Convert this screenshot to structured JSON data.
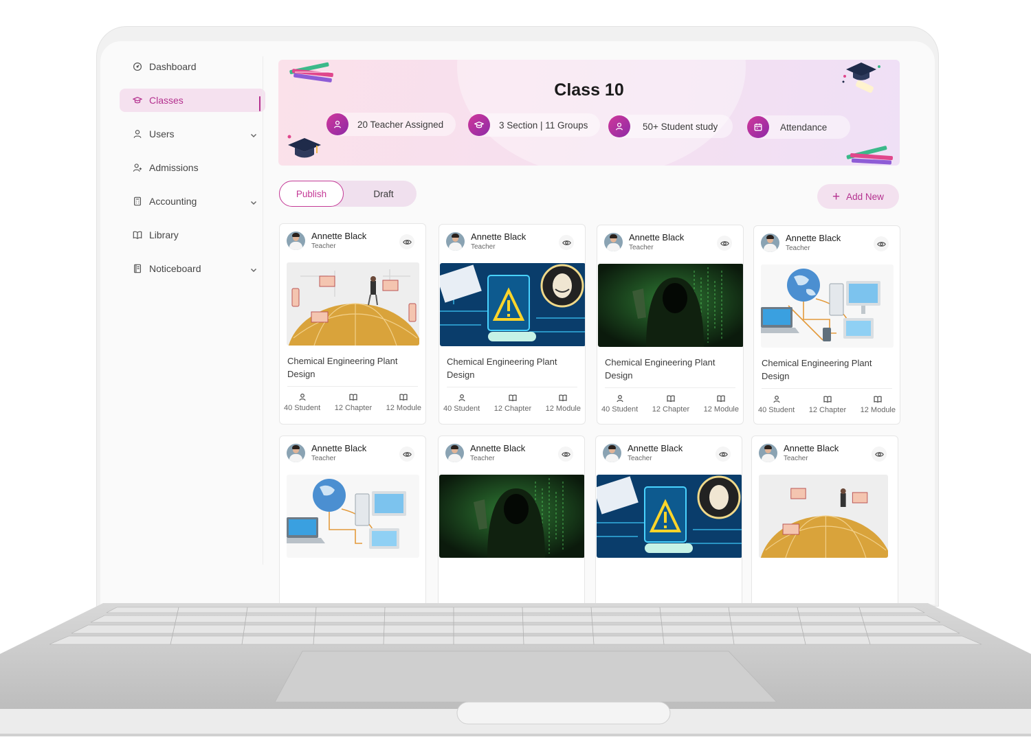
{
  "sidebar": {
    "items": [
      {
        "label": "Dashboard",
        "icon": "dashboard-icon",
        "active": false,
        "expandable": false
      },
      {
        "label": "Classes",
        "icon": "graduation-cap-icon",
        "active": true,
        "expandable": false
      },
      {
        "label": "Users",
        "icon": "user-icon",
        "active": false,
        "expandable": true
      },
      {
        "label": "Admissions",
        "icon": "user-plus-icon",
        "active": false,
        "expandable": false
      },
      {
        "label": "Accounting",
        "icon": "calculator-icon",
        "active": false,
        "expandable": true
      },
      {
        "label": "Library",
        "icon": "book-icon",
        "active": false,
        "expandable": false
      },
      {
        "label": "Noticeboard",
        "icon": "notice-icon",
        "active": false,
        "expandable": true
      }
    ]
  },
  "banner": {
    "title": "Class 10",
    "stats": [
      {
        "label": "20 Teacher Assigned",
        "icon": "user-icon"
      },
      {
        "label": "3 Section | 11 Groups",
        "icon": "graduation-cap-icon"
      },
      {
        "label": "50+ Student study",
        "icon": "user-icon"
      },
      {
        "label": "Attendance",
        "icon": "calendar-icon"
      }
    ]
  },
  "tabs": {
    "publish": "Publish",
    "draft": "Draft",
    "selected": "Publish"
  },
  "add_new": {
    "label": "Add New"
  },
  "colors": {
    "accent": "#b4318f",
    "accent_soft": "#f5e1ef"
  },
  "cards": [
    {
      "name": "Annette Black",
      "role": "Teacher",
      "image": "globe-remote-work",
      "title": "Chemical Engineering Plant Design",
      "students": "40 Student",
      "chapters": "12 Chapter",
      "modules": "12 Module"
    },
    {
      "name": "Annette Black",
      "role": "Teacher",
      "image": "hacked-warning",
      "title": "Chemical Engineering Plant Design",
      "students": "40 Student",
      "chapters": "12 Chapter",
      "modules": "12 Module"
    },
    {
      "name": "Annette Black",
      "role": "Teacher",
      "image": "hooded-hacker",
      "title": "Chemical Engineering Plant Design",
      "students": "40 Student",
      "chapters": "12 Chapter",
      "modules": "12 Module"
    },
    {
      "name": "Annette Black",
      "role": "Teacher",
      "image": "network-computers",
      "title": "Chemical Engineering Plant Design",
      "students": "40 Student",
      "chapters": "12 Chapter",
      "modules": "12 Module"
    },
    {
      "name": "Annette Black",
      "role": "Teacher",
      "image": "network-computers"
    },
    {
      "name": "Annette Black",
      "role": "Teacher",
      "image": "hooded-hacker"
    },
    {
      "name": "Annette Black",
      "role": "Teacher",
      "image": "hacked-warning"
    },
    {
      "name": "Annette Black",
      "role": "Teacher",
      "image": "globe-remote-work"
    }
  ]
}
